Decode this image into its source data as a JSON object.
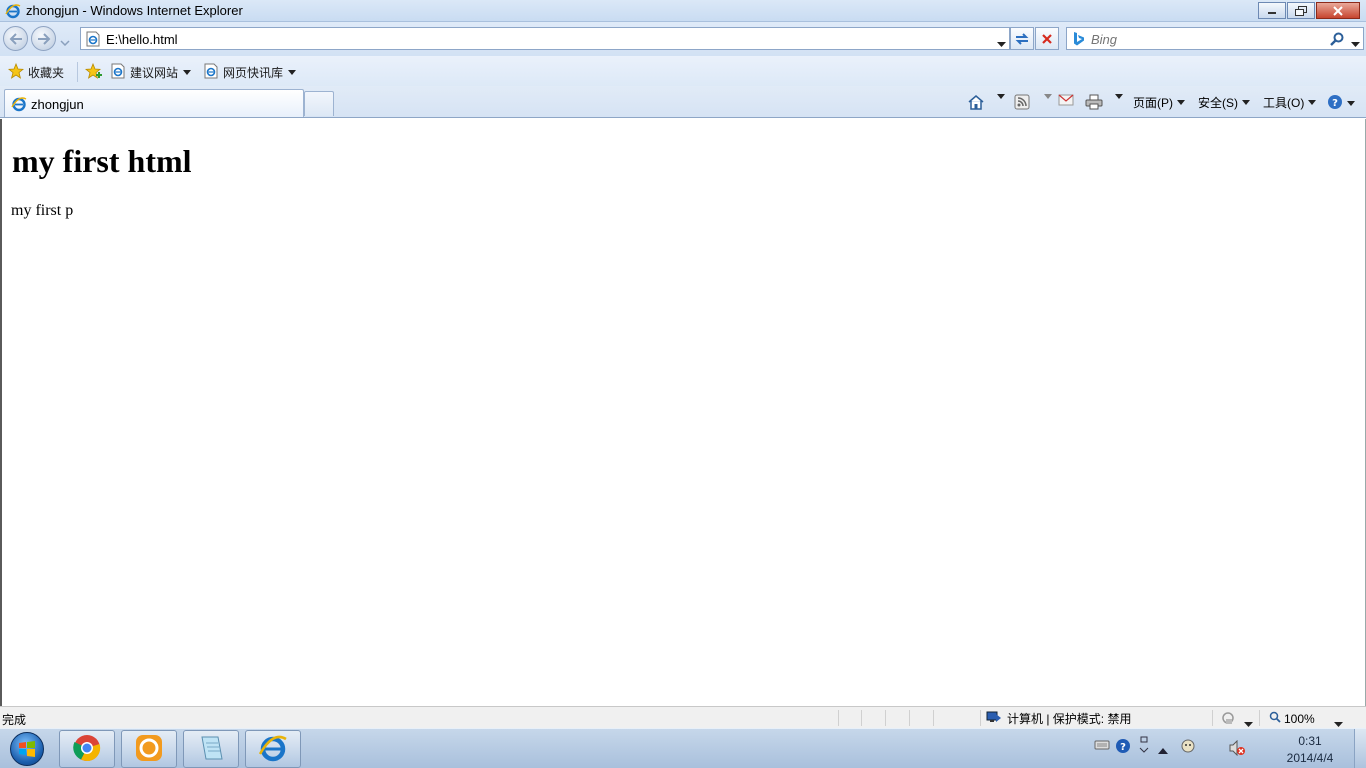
{
  "window": {
    "title": "zhongjun - Windows Internet Explorer"
  },
  "address_bar": {
    "url": "E:\\hello.html"
  },
  "search": {
    "placeholder": "Bing"
  },
  "favorites_bar": {
    "favorites_label": "收藏夹",
    "items": [
      {
        "label": "建议网站",
        "icon": "ie-page-icon"
      },
      {
        "label": "网页快讯库",
        "icon": "ie-page-icon"
      }
    ]
  },
  "tabs": [
    {
      "label": "zhongjun",
      "active": true
    }
  ],
  "command_bar": {
    "page_label": "页面(P)",
    "safety_label": "安全(S)",
    "tools_label": "工具(O)"
  },
  "page": {
    "heading": "my first html",
    "paragraph": "my first p"
  },
  "status_bar": {
    "status_text": "完成",
    "zone_text": "计算机 | 保护模式: 禁用",
    "zoom": "100%"
  },
  "taskbar": {
    "pinned": [
      "chrome-icon",
      "app-orange-icon",
      "notepad-icon",
      "internet-explorer-icon"
    ],
    "clock_time": "0:31",
    "clock_date": "2014/4/4"
  },
  "colors": {
    "chrome_bg": "#d6e3f4",
    "border": "#8da6c8",
    "taskbar": "#a9c0dc",
    "close_button": "#c7452f"
  }
}
